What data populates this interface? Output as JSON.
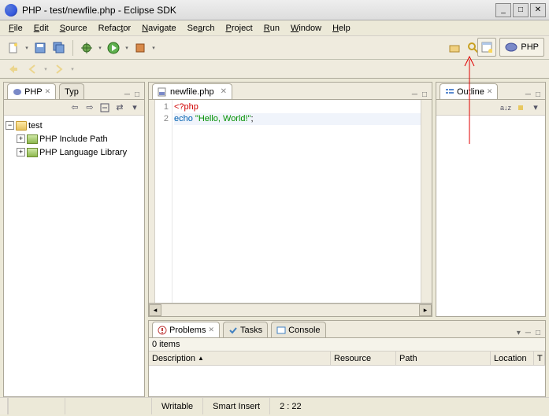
{
  "window": {
    "title": "PHP - test/newfile.php - Eclipse SDK"
  },
  "menu": {
    "items": [
      "File",
      "Edit",
      "Source",
      "Refactor",
      "Navigate",
      "Search",
      "Project",
      "Run",
      "Window",
      "Help"
    ]
  },
  "perspective": {
    "label": "PHP"
  },
  "explorer": {
    "tab1": "PHP",
    "tab2": "Typ",
    "root": "test",
    "node1": "PHP Include Path",
    "node2": "PHP Language Library"
  },
  "editor": {
    "filename": "newfile.php",
    "gutter": {
      "l1": "1",
      "l2": "2"
    },
    "code": {
      "line1_tag": "<?php",
      "line2_kw": "echo",
      "line2_str": "\"Hello, World!\"",
      "line2_semi": ";"
    }
  },
  "outline": {
    "title": "Outline"
  },
  "problems": {
    "tab1": "Problems",
    "tab2": "Tasks",
    "tab3": "Console",
    "count": "0 items",
    "cols": {
      "desc": "Description",
      "res": "Resource",
      "path": "Path",
      "loc": "Location",
      "type": "T"
    }
  },
  "status": {
    "writable": "Writable",
    "insert": "Smart Insert",
    "pos": "2 : 22"
  }
}
